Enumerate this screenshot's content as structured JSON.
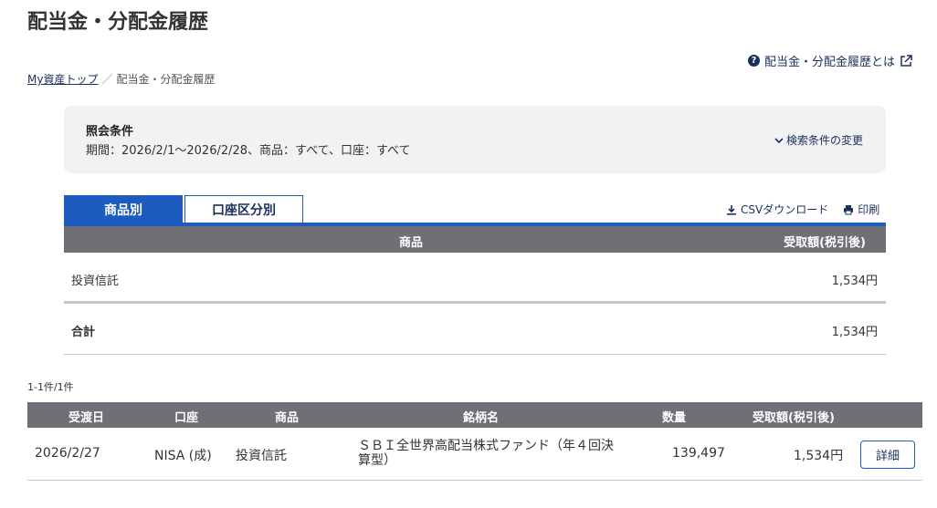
{
  "page": {
    "title": "配当金・分配金履歴"
  },
  "help": {
    "label": "配当金・分配金履歴とは",
    "icon": "question-circle-icon",
    "ext_icon": "external-link-icon"
  },
  "breadcrumb": {
    "home": "My資産トップ",
    "separator": "／",
    "current": "配当金・分配金履歴"
  },
  "conditions": {
    "title": "照会条件",
    "text": "期間：2026/2/1～2026/2/28、商品：すべて、口座：すべて",
    "change_label": "検索条件の変更"
  },
  "tabs": [
    {
      "label": "商品別",
      "active": true
    },
    {
      "label": "口座区分別",
      "active": false
    }
  ],
  "tools": {
    "csv_label": "CSVダウンロード",
    "print_label": "印刷"
  },
  "summary": {
    "headers": {
      "product": "商品",
      "amount": "受取額(税引後)"
    },
    "rows": [
      {
        "product": "投資信託",
        "amount": "1,534円"
      }
    ],
    "total": {
      "label": "合計",
      "amount": "1,534円"
    }
  },
  "count": "1-1件/1件",
  "detail": {
    "headers": {
      "date": "受渡日",
      "account": "口座",
      "product": "商品",
      "name": "銘柄名",
      "qty": "数量",
      "amount": "受取額(税引後)"
    },
    "rows": [
      {
        "date": "2026/2/27",
        "account": "NISA (成)",
        "product": "投資信託",
        "name": "ＳＢＩ全世界高配当株式ファンド（年４回決算型）",
        "qty": "139,497",
        "amount": "1,534円",
        "button": "詳細"
      }
    ]
  },
  "colors": {
    "accent": "#1e5bbf",
    "header_bg": "#6e7076",
    "panel_bg": "#f2f2f4",
    "link": "#1a2f5c"
  }
}
